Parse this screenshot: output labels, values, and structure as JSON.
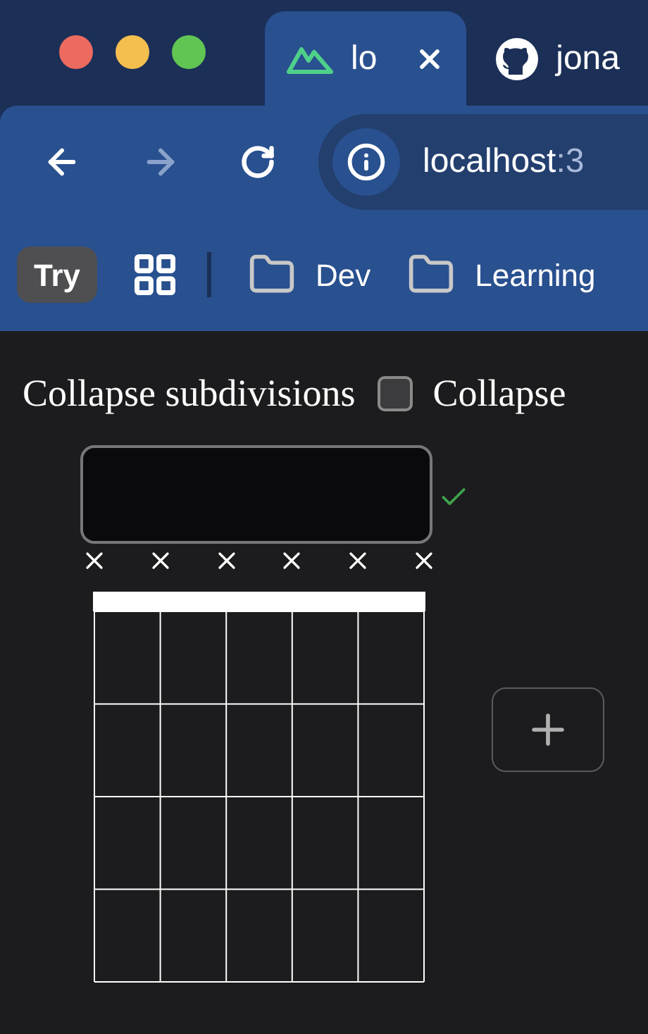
{
  "browser": {
    "tabs": [
      {
        "title": "lo",
        "selected": true
      },
      {
        "title": "jona",
        "selected": false
      }
    ],
    "address": {
      "host": "localhost",
      "port": ":3"
    },
    "nav": {
      "back_disabled": false,
      "forward_disabled": true
    },
    "bookmarks": [
      {
        "kind": "badge",
        "label": "Try"
      },
      {
        "kind": "apps"
      },
      {
        "kind": "separator"
      },
      {
        "kind": "folder",
        "label": "Dev"
      },
      {
        "kind": "folder",
        "label": "Learning"
      }
    ]
  },
  "options": [
    {
      "label": "Collapse subdivisions",
      "checked": false
    },
    {
      "label": "Collapse"
    }
  ],
  "chord": {
    "name_field": {
      "valid": true
    },
    "strings": [
      {
        "muted": true
      },
      {
        "muted": true
      },
      {
        "muted": true
      },
      {
        "muted": true
      },
      {
        "muted": true
      },
      {
        "muted": true
      }
    ]
  }
}
